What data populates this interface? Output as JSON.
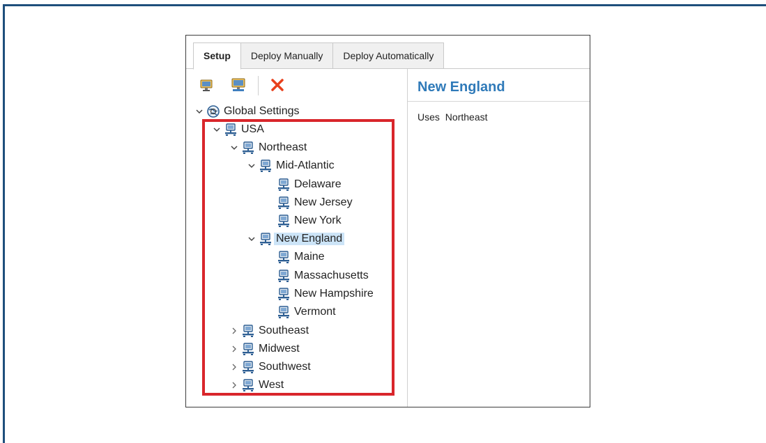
{
  "tabs": [
    {
      "label": "Setup",
      "active": true
    },
    {
      "label": "Deploy Manually",
      "active": false
    },
    {
      "label": "Deploy Automatically",
      "active": false
    }
  ],
  "toolbar": {
    "buttons": [
      {
        "icon": "add-computer-icon"
      },
      {
        "icon": "add-group-icon"
      },
      {
        "icon": "delete-icon",
        "color": "#e8401c"
      }
    ]
  },
  "tree": [
    {
      "label": "Global Settings",
      "icon": "globe-icon",
      "expanded": true
    },
    {
      "label": "USA",
      "icon": "network-icon",
      "expanded": true
    },
    {
      "label": "Northeast",
      "icon": "network-icon",
      "expanded": true
    },
    {
      "label": "Mid-Atlantic",
      "icon": "network-icon",
      "expanded": true
    },
    {
      "label": "Delaware",
      "icon": "network-icon"
    },
    {
      "label": "New Jersey",
      "icon": "network-icon"
    },
    {
      "label": "New York",
      "icon": "network-icon"
    },
    {
      "label": "New England",
      "icon": "network-icon",
      "expanded": true,
      "selected": true
    },
    {
      "label": "Maine",
      "icon": "network-icon"
    },
    {
      "label": "Massachusetts",
      "icon": "network-icon"
    },
    {
      "label": "New Hampshire",
      "icon": "network-icon"
    },
    {
      "label": "Vermont",
      "icon": "network-icon"
    },
    {
      "label": "Southeast",
      "icon": "network-icon",
      "expanded": false
    },
    {
      "label": "Midwest",
      "icon": "network-icon",
      "expanded": false
    },
    {
      "label": "Southwest",
      "icon": "network-icon",
      "expanded": false
    },
    {
      "label": "West",
      "icon": "network-icon",
      "expanded": false
    }
  ],
  "details": {
    "title": "New England",
    "uses_label": "Uses",
    "uses_value": "Northeast"
  },
  "colors": {
    "accent": "#2f7ab9",
    "selection": "#cce4f7",
    "highlight": "#d9262b",
    "frame": "#1e4f7c"
  }
}
